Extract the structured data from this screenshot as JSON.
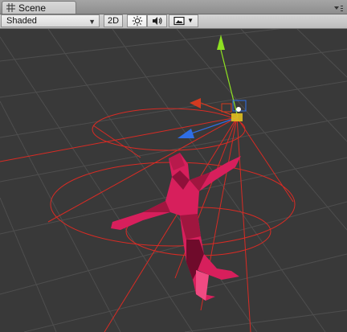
{
  "tab": {
    "title": "Scene",
    "icon": "scene-grid-icon"
  },
  "toolbar": {
    "shading_mode": "Shaded",
    "mode_2d_label": "2D",
    "lighting_icon": "sun-icon",
    "audio_icon": "speaker-icon",
    "effects_icon": "image-icon",
    "dropdown_icon": "dropdown-arrow-icon"
  },
  "viewport": {
    "object": "humanoid-model",
    "gizmo": "move-gizmo",
    "colors": {
      "model": "#d71f5c",
      "light_lines": "#d92b24",
      "axis_x": "#d43a20",
      "axis_y": "#8ee022",
      "axis_z": "#2f6ee6",
      "center": "#e0c020",
      "background": "#393939",
      "grid": "#4f4f4f"
    }
  }
}
